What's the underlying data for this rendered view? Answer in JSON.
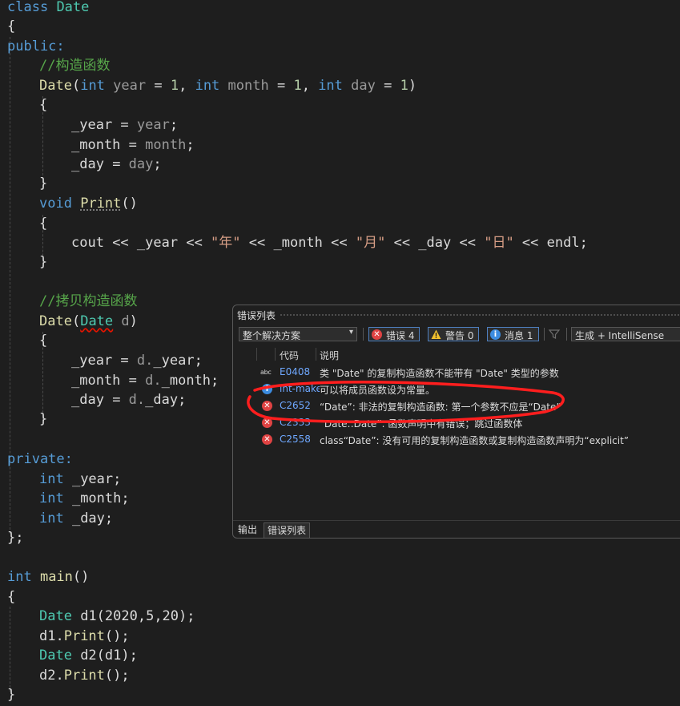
{
  "code": {
    "l1": {
      "kw": "class",
      "name": "Date"
    },
    "l2": "{",
    "l3": "public:",
    "l4": "//构造函数",
    "l5": {
      "name": "Date",
      "open": "(",
      "t1": "int",
      "p1": "year",
      "eq1": " = ",
      "v1": "1",
      "c1": ", ",
      "t2": "int",
      "p2": "month",
      "eq2": " = ",
      "v2": "1",
      "c2": ", ",
      "t3": "int",
      "p3": "day",
      "eq3": " = ",
      "v3": "1",
      "close": ")"
    },
    "l6": "{",
    "l7": {
      "m": "_year",
      "op": " = ",
      "p": "year",
      "end": ";"
    },
    "l8": {
      "m": "_month",
      "op": " = ",
      "p": "month",
      "end": ";"
    },
    "l9": {
      "m": "_day",
      "op": " = ",
      "p": "day",
      "end": ";"
    },
    "l10": "}",
    "l11": {
      "kw": "void",
      "name": "Print",
      "rest": "()"
    },
    "l12": "{",
    "l13": {
      "cout": "cout",
      "s1": " << ",
      "y": "_year",
      "s2": " << ",
      "str1": "\"年\"",
      "s3": " << ",
      "m": "_month",
      "s4": " << ",
      "str2": "\"月\"",
      "s5": " << ",
      "d": "_day",
      "s6": " << ",
      "str3": "\"日\"",
      "s7": " << ",
      "endl": "endl",
      "end": ";"
    },
    "l14": "}",
    "l16": "//拷贝构造函数",
    "l17": {
      "name": "Date",
      "open": "(",
      "type": "Date",
      "param": " d",
      "close": ")"
    },
    "l18": "{",
    "l19": {
      "m": "_year",
      "op": " = ",
      "obj": "d.",
      "f": "_year",
      "end": ";"
    },
    "l20": {
      "m": "_month",
      "op": " = ",
      "obj": "d.",
      "f": "_month",
      "end": ";"
    },
    "l21": {
      "m": "_day",
      "op": " = ",
      "obj": "d.",
      "f": "_day",
      "end": ";"
    },
    "l22": "}",
    "l24": "private:",
    "l25": {
      "t": "int",
      "v": " _year;"
    },
    "l26": {
      "t": "int",
      "v": " _month;"
    },
    "l27": {
      "t": "int",
      "v": " _day;"
    },
    "l28": "};",
    "l30": {
      "t": "int",
      "f": " main",
      "rest": "()"
    },
    "l31": "{",
    "l32": {
      "t": "Date",
      "v": " d1",
      "args": "(2020,5,20);"
    },
    "l33": {
      "obj": "d1.",
      "f": "Print",
      "rest": "();"
    },
    "l34": {
      "t": "Date",
      "v": " d2",
      "args": "(d1);"
    },
    "l35": {
      "obj": "d2.",
      "f": "Print",
      "rest": "();"
    },
    "l36": "}"
  },
  "error_list": {
    "title": "错误列表",
    "scope": "整个解决方案",
    "errors_btn": "错误 4",
    "warnings_btn": "警告 0",
    "messages_btn": "消息 1",
    "build_mode": "生成 + IntelliSense",
    "col_code": "代码",
    "col_desc": "说明",
    "rows": [
      {
        "icon": "abc",
        "code": "E0408",
        "desc": "类 \"Date\" 的复制构造函数不能带有 \"Date\" 类型的参数"
      },
      {
        "icon": "info",
        "code": "lnt-make",
        "desc": "可以将成员函数设为常量。"
      },
      {
        "icon": "error",
        "code": "C2652",
        "desc": "“Date”: 非法的复制构造函数: 第一个参数不应是“Date”"
      },
      {
        "icon": "error",
        "code": "C2333",
        "desc": "“Date::Date”: 函数声明中有错误；跳过函数体"
      },
      {
        "icon": "error",
        "code": "C2558",
        "desc": "class“Date”: 没有可用的复制构造函数或复制构造函数声明为“explicit”"
      }
    ],
    "tab_output": "输出",
    "tab_errors": "错误列表"
  },
  "colors": {
    "keyword": "#569cd6",
    "type": "#4ec9b0",
    "function": "#dcdcaa",
    "comment": "#57a64a",
    "string": "#d69d85",
    "number": "#b5cea8",
    "error": "#e04343",
    "info": "#3c8ce0",
    "annotation": "#ff1e1e"
  }
}
